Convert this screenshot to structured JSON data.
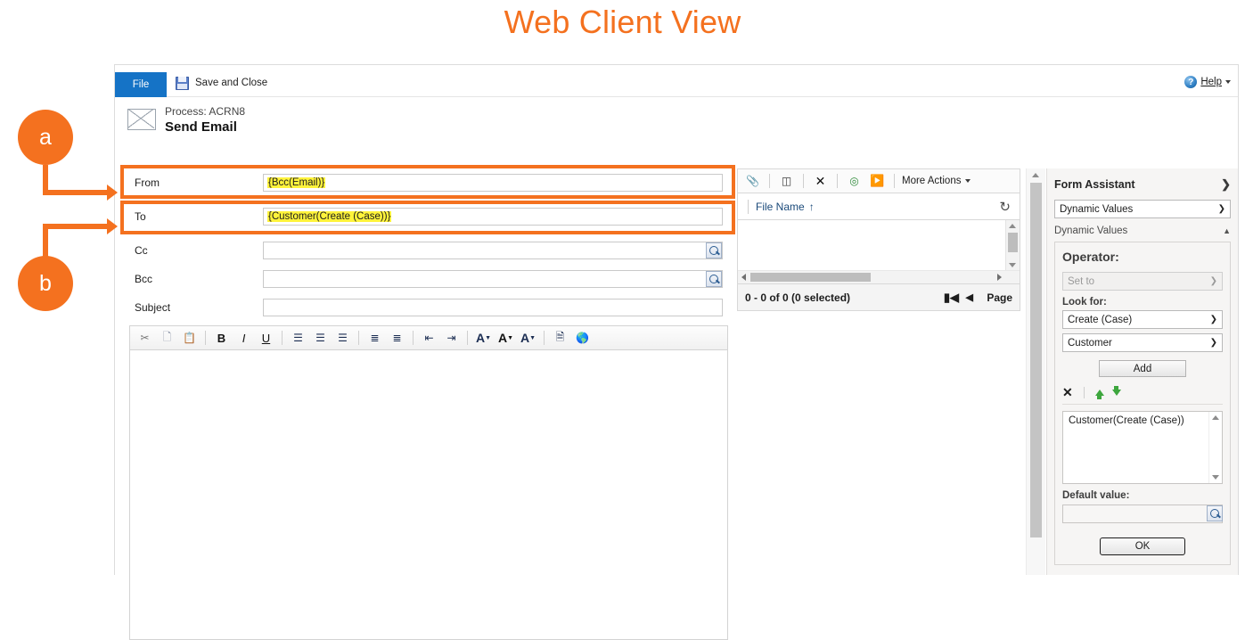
{
  "page": {
    "title": "Web Client View",
    "title_color": "#F4711F"
  },
  "ribbon": {
    "file_tab": "File",
    "save_and_close": "Save and Close",
    "help": "Help",
    "save_icon": "save-disk-icon",
    "help_icon": "help-question-icon",
    "dropdown_icon": "chevron-down-icon"
  },
  "record": {
    "process_label": "Process: ACRN8",
    "entity_name": "Send Email",
    "entity_icon": "envelope-icon"
  },
  "fields": [
    {
      "label": "From",
      "value": "{Bcc(Email)}",
      "highlighted": true,
      "lookup": false,
      "annotated": true
    },
    {
      "label": "To",
      "value": "{Customer(Create (Case))}",
      "highlighted": true,
      "lookup": false,
      "annotated": true
    },
    {
      "label": "Cc",
      "value": "",
      "highlighted": false,
      "lookup": true,
      "annotated": false
    },
    {
      "label": "Bcc",
      "value": "",
      "highlighted": false,
      "lookup": true,
      "annotated": false
    },
    {
      "label": "Subject",
      "value": "",
      "highlighted": false,
      "lookup": false,
      "annotated": false
    }
  ],
  "editor": {
    "body_value": "",
    "toolbar": [
      {
        "name": "cut-icon",
        "glyph": "✂"
      },
      {
        "name": "copy-icon",
        "glyph": "❐"
      },
      {
        "name": "paste-icon",
        "glyph": "ὌB"
      },
      {
        "name": "separator",
        "glyph": ""
      },
      {
        "name": "bold-icon",
        "glyph": "B"
      },
      {
        "name": "italic-icon",
        "glyph": "I"
      },
      {
        "name": "underline-icon",
        "glyph": "U"
      },
      {
        "name": "separator",
        "glyph": ""
      },
      {
        "name": "align-left-icon",
        "glyph": "☰"
      },
      {
        "name": "align-center-icon",
        "glyph": "☰"
      },
      {
        "name": "align-right-icon",
        "glyph": "☰"
      },
      {
        "name": "separator",
        "glyph": ""
      },
      {
        "name": "numbered-list-icon",
        "glyph": "≣"
      },
      {
        "name": "bulleted-list-icon",
        "glyph": "≣"
      },
      {
        "name": "separator",
        "glyph": ""
      },
      {
        "name": "decrease-indent-icon",
        "glyph": "⇤"
      },
      {
        "name": "increase-indent-icon",
        "glyph": "⇥"
      },
      {
        "name": "separator",
        "glyph": ""
      },
      {
        "name": "text-highlight-icon",
        "glyph": "A"
      },
      {
        "name": "font-size-icon",
        "glyph": "A"
      },
      {
        "name": "font-color-icon",
        "glyph": "A"
      },
      {
        "name": "separator",
        "glyph": ""
      },
      {
        "name": "insert-template-icon",
        "glyph": "Ὄ4"
      },
      {
        "name": "insert-link-icon",
        "glyph": "ἱ0"
      }
    ]
  },
  "attachments": {
    "toolbar": {
      "attach_file_label": "attach-file-icon",
      "attach_article_label": "attach-article-icon",
      "remove_label": "remove-icon",
      "refresh_icon": "refresh-icon",
      "run_icon": "run-icon",
      "more_actions": "More Actions",
      "dropdown_icon": "chevron-down-icon"
    },
    "column_header": "File Name",
    "sort_indicator": "↑",
    "refresh_glyph": "↻",
    "status": "0 - 0 of 0 (0 selected)",
    "page_label": "Page",
    "first_page_icon": "first-page-icon",
    "prev_page_icon": "previous-page-icon"
  },
  "form_assistant": {
    "title": "Form Assistant",
    "expand_icon": "chevron-right-icon",
    "type_select": "Dynamic Values",
    "section_header": "Dynamic Values",
    "collapse_icon": "chevron-up-icon",
    "operator_label": "Operator:",
    "operator_value": "Set to",
    "look_for_label": "Look for:",
    "look_for_entity": "Create (Case)",
    "look_for_field": "Customer",
    "add_button": "Add",
    "remove_icon": "remove-x-icon",
    "move_up_icon": "move-up-arrow-icon",
    "move_down_icon": "move-down-arrow-icon",
    "selected_values": "Customer(Create (Case))",
    "default_value_label": "Default value:",
    "default_value": "",
    "ok_button": "OK"
  },
  "callouts": [
    {
      "id": "a",
      "label": "a",
      "target": "From field"
    },
    {
      "id": "b",
      "label": "b",
      "target": "To field"
    }
  ]
}
